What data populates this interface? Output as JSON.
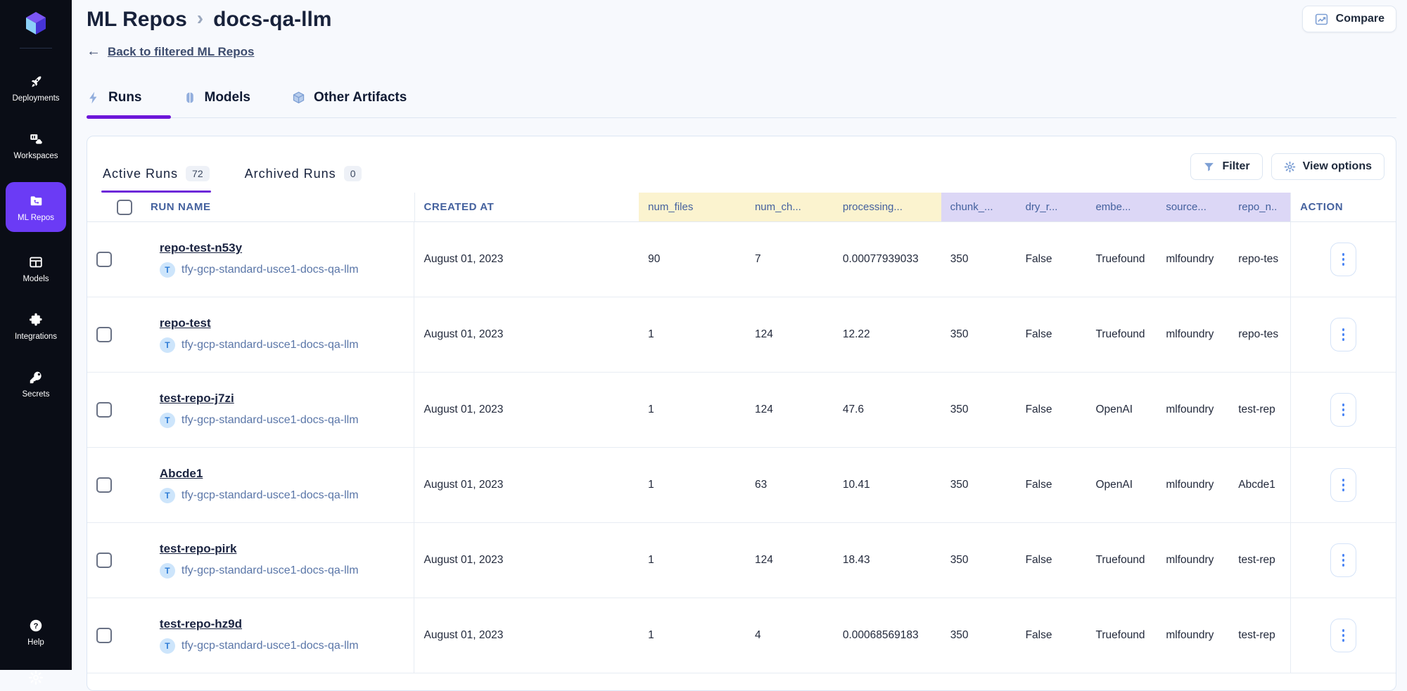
{
  "colors": {
    "sidebar_bg": "#0a0d16",
    "nav_active": "#6b3bf5",
    "tab_underline": "#6d16d9",
    "header_yellow": "#fbf3cf",
    "header_lavender": "#dcd7f6",
    "header_text": "#44619e"
  },
  "sidebar": {
    "items": [
      {
        "label": "Deployments"
      },
      {
        "label": "Workspaces"
      },
      {
        "label": "ML Repos"
      },
      {
        "label": "Models"
      },
      {
        "label": "Integrations"
      },
      {
        "label": "Secrets"
      }
    ],
    "bottom": {
      "help_label": "Help"
    }
  },
  "header": {
    "breadcrumb_parent": "ML Repos",
    "breadcrumb_separator": "›",
    "breadcrumb_current": "docs-qa-llm",
    "back_arrow": "←",
    "back_link": "Back to filtered ML Repos",
    "compare_label": "Compare"
  },
  "tabs": {
    "runs": "Runs",
    "models": "Models",
    "other_artifacts": "Other Artifacts"
  },
  "panel": {
    "active_tab_label": "Active Runs",
    "active_count": "72",
    "archived_tab_label": "Archived Runs",
    "archived_count": "0",
    "filter_label": "Filter",
    "view_options_label": "View options"
  },
  "table": {
    "cluster_badge": "T",
    "columns": {
      "run_name": "RUN NAME",
      "created_at": "CREATED AT",
      "num_files": "num_files",
      "num_chunks": "num_ch...",
      "processing": "processing...",
      "chunk": "chunk_...",
      "dry_run": "dry_r...",
      "embedder": "embe...",
      "source": "source...",
      "repo_name": "repo_n..",
      "action": "ACTION"
    },
    "rows": [
      {
        "name": "repo-test-n53y",
        "cluster": "tfy-gcp-standard-usce1-docs-qa-llm",
        "created": "August 01, 2023",
        "num_files": "90",
        "num_chunks": "7",
        "processing": "0.00077939033",
        "chunk_size": "350",
        "dry_run": "False",
        "embedder": "Truefound",
        "source": "mlfoundry",
        "repo_name": "repo-tes"
      },
      {
        "name": "repo-test",
        "cluster": "tfy-gcp-standard-usce1-docs-qa-llm",
        "created": "August 01, 2023",
        "num_files": "1",
        "num_chunks": "124",
        "processing": "12.22",
        "chunk_size": "350",
        "dry_run": "False",
        "embedder": "Truefound",
        "source": "mlfoundry",
        "repo_name": "repo-tes"
      },
      {
        "name": "test-repo-j7zi",
        "cluster": "tfy-gcp-standard-usce1-docs-qa-llm",
        "created": "August 01, 2023",
        "num_files": "1",
        "num_chunks": "124",
        "processing": "47.6",
        "chunk_size": "350",
        "dry_run": "False",
        "embedder": "OpenAI",
        "source": "mlfoundry",
        "repo_name": "test-rep"
      },
      {
        "name": "Abcde1",
        "cluster": "tfy-gcp-standard-usce1-docs-qa-llm",
        "created": "August 01, 2023",
        "num_files": "1",
        "num_chunks": "63",
        "processing": "10.41",
        "chunk_size": "350",
        "dry_run": "False",
        "embedder": "OpenAI",
        "source": "mlfoundry",
        "repo_name": "Abcde1"
      },
      {
        "name": "test-repo-pirk",
        "cluster": "tfy-gcp-standard-usce1-docs-qa-llm",
        "created": "August 01, 2023",
        "num_files": "1",
        "num_chunks": "124",
        "processing": "18.43",
        "chunk_size": "350",
        "dry_run": "False",
        "embedder": "Truefound",
        "source": "mlfoundry",
        "repo_name": "test-rep"
      },
      {
        "name": "test-repo-hz9d",
        "cluster": "tfy-gcp-standard-usce1-docs-qa-llm",
        "created": "August 01, 2023",
        "num_files": "1",
        "num_chunks": "4",
        "processing": "0.00068569183",
        "chunk_size": "350",
        "dry_run": "False",
        "embedder": "Truefound",
        "source": "mlfoundry",
        "repo_name": "test-rep"
      }
    ]
  }
}
